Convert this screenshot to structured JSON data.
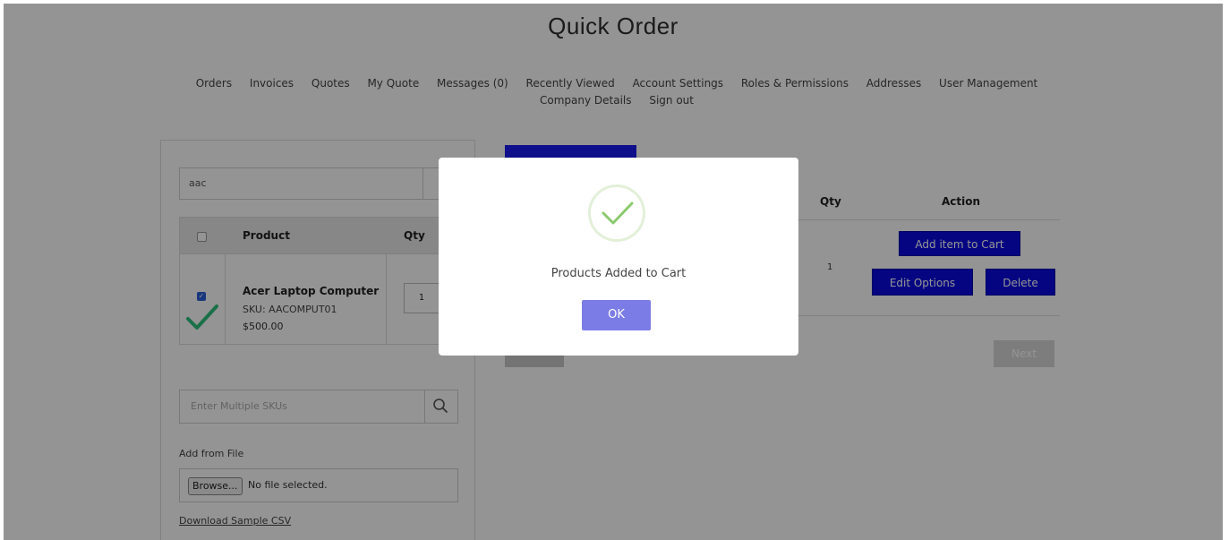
{
  "page": {
    "title": "Quick Order"
  },
  "nav": {
    "items": [
      "Orders",
      "Invoices",
      "Quotes",
      "My Quote",
      "Messages (0)",
      "Recently Viewed",
      "Account Settings",
      "Roles & Permissions",
      "Addresses",
      "User Management",
      "Company Details",
      "Sign out"
    ]
  },
  "search": {
    "value": "aac"
  },
  "product_table": {
    "headers": {
      "product": "Product",
      "qty": "Qty"
    },
    "row": {
      "name": "Acer Laptop Computer",
      "sku": "SKU: AACOMPUT01",
      "price": "$500.00",
      "qty": "1",
      "checked": true
    }
  },
  "multi_sku": {
    "placeholder": "Enter Multiple SKUs"
  },
  "add_file": {
    "label": "Add from File",
    "browse_label": "Browse...",
    "status": "No file selected.",
    "download_link": "Download Sample CSV"
  },
  "cart_table": {
    "headers": {
      "qty": "Qty",
      "action": "Action"
    },
    "row": {
      "qty": "1"
    },
    "buttons": {
      "add_to_cart": "Add item to Cart",
      "edit_options": "Edit Options",
      "delete": "Delete"
    },
    "pagination": {
      "next": "Next"
    }
  },
  "modal": {
    "message": "Products Added to Cart",
    "ok_label": "OK",
    "icon": "check-circle-icon"
  },
  "colors": {
    "primary_button": "#0a0ae0",
    "ok_button": "#7c7ce6",
    "success_check": "#8bc96f",
    "row_check": "#2ec27e"
  }
}
